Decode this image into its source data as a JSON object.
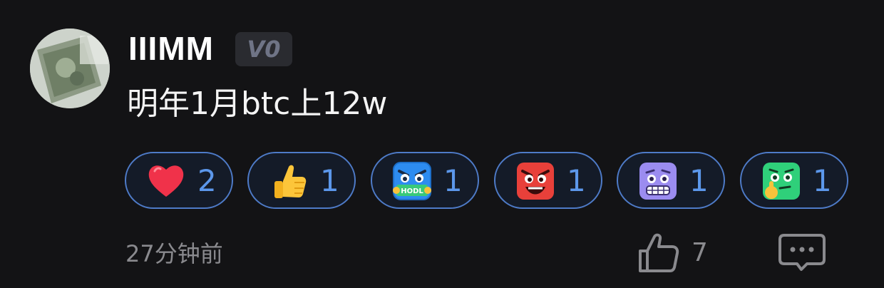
{
  "comment": {
    "username": "IIIMM",
    "level_badge": "V0",
    "text": "明年1月btc上12w",
    "timestamp": "27分钟前",
    "like_count": "7"
  },
  "reactions": [
    {
      "icon": "red-heart-emoji",
      "count": "2"
    },
    {
      "icon": "thumbs-up-emoji",
      "count": "1"
    },
    {
      "icon": "hodl-bot-emoji",
      "count": "1"
    },
    {
      "icon": "angry-red-face-emoji",
      "count": "1"
    },
    {
      "icon": "grimacing-purple-face-emoji",
      "count": "1"
    },
    {
      "icon": "thinking-green-face-emoji",
      "count": "1"
    }
  ],
  "colors": {
    "background": "#131315",
    "pill_border": "#4e7bc8",
    "pill_count": "#5c97ea",
    "muted_text": "#8a8a8e"
  }
}
